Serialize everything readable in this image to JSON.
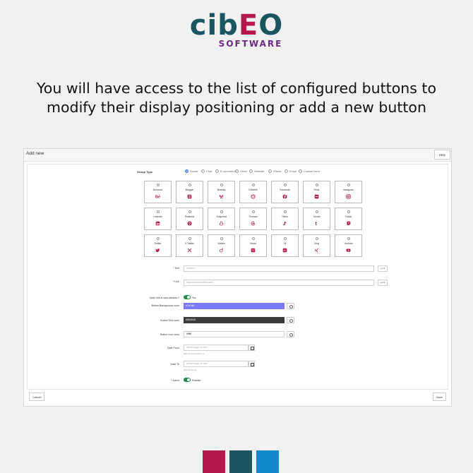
{
  "logo": {
    "part1": "cib",
    "part2": "E",
    "part3": "O",
    "sub": "SOFTWARE"
  },
  "headline": "You will have access to the list of configured buttons to modify their display positioning or add a new button",
  "window": {
    "title": "Add new",
    "help": "Help"
  },
  "group_type": {
    "label": "Group Type",
    "options": [
      "Social",
      "Chat",
      "E-commerce",
      "Other",
      "Website",
      "Phone",
      "Email",
      "Contact form"
    ]
  },
  "networks": [
    {
      "name": "Behance",
      "icon": "behance-icon"
    },
    {
      "name": "Blogger",
      "icon": "blogger-icon"
    },
    {
      "name": "Bluesky",
      "icon": "bluesky-icon"
    },
    {
      "name": "Dribbble",
      "icon": "dribbble-icon"
    },
    {
      "name": "Facebook",
      "icon": "facebook-icon"
    },
    {
      "name": "Flickr",
      "icon": "flickr-icon"
    },
    {
      "name": "Instagram",
      "icon": "instagram-icon"
    },
    {
      "name": "LinkedIn",
      "icon": "linkedin-icon"
    },
    {
      "name": "Pinterest",
      "icon": "pinterest-icon"
    },
    {
      "name": "Snapchat",
      "icon": "snapchat-icon"
    },
    {
      "name": "Threads",
      "icon": "threads-icon"
    },
    {
      "name": "Tiktok",
      "icon": "tiktok-icon"
    },
    {
      "name": "Tumblr",
      "icon": "tumblr-icon"
    },
    {
      "name": "Twitch",
      "icon": "twitch-icon"
    },
    {
      "name": "Twitter",
      "icon": "twitter-icon"
    },
    {
      "name": "X Twitter",
      "icon": "x-twitter-icon"
    },
    {
      "name": "Viadeo",
      "icon": "viadeo-icon"
    },
    {
      "name": "Vimeo",
      "icon": "vimeo-icon"
    },
    {
      "name": "Vk",
      "icon": "vk-icon"
    },
    {
      "name": "Xing",
      "icon": "xing-icon"
    },
    {
      "name": "Youtube",
      "icon": "youtube-icon"
    }
  ],
  "form": {
    "text_label": "* Text",
    "text_placeholder": "Linkedin",
    "link_label": "* Link",
    "link_placeholder": "https://www.linkedin.com/",
    "lang": "en ▾",
    "new_window_label": "Open link in new window ?",
    "new_window_value": "Yes",
    "bg_label": "Button Background color",
    "bg_value": "#7a7aff",
    "bg_color": "#7a7aff",
    "text_color_label": "Button Text color",
    "text_color_value": "#454545",
    "text_color": "#3a3a3a",
    "icon_color_label": "Button Icon color",
    "icon_color_value": "#ffffff",
    "date_from_label": "Date From",
    "date_from_placeholder": "dd/mm/yyyy  hh:mm",
    "date_from_hint": "date and time when is",
    "date_to_label": "Date To",
    "date_to_placeholder": "dd/mm/yyyy  hh:mm",
    "date_to_hint": "date and time",
    "active_label": "* Active",
    "active_value": "Enabled"
  },
  "footer": {
    "cancel": "Cancel",
    "save": "Save"
  },
  "colors": {
    "brand_pink": "#b5174f",
    "brand_teal": "#1a5560",
    "brand_blue": "#1188c9",
    "icon": "#b5174f"
  }
}
